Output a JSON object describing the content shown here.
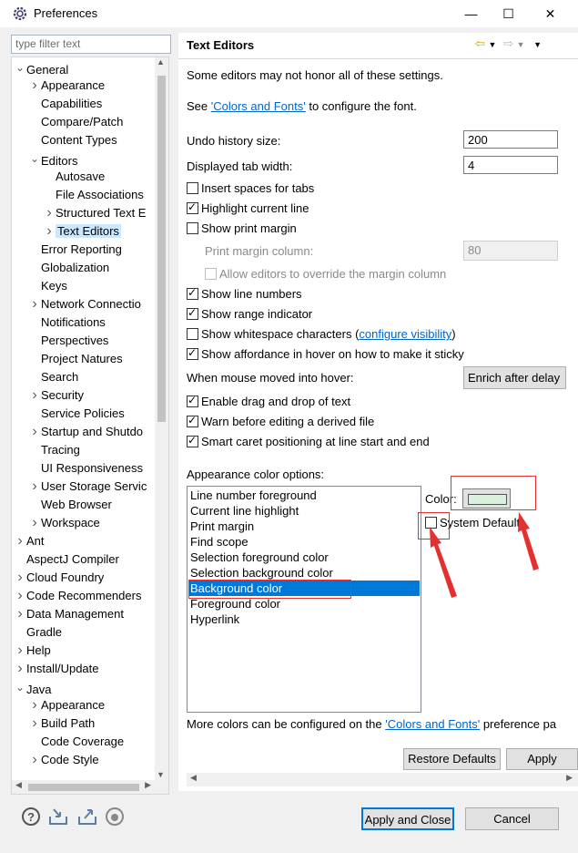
{
  "window": {
    "title": "Preferences",
    "controls": {
      "minimize": "—",
      "maximize": "☐",
      "close": "✕"
    }
  },
  "filter": {
    "placeholder": "type filter text"
  },
  "tree": {
    "items": [
      {
        "label": "General",
        "level": 0,
        "twisty": "expanded"
      },
      {
        "label": "Appearance",
        "level": 1,
        "twisty": "collapsed"
      },
      {
        "label": "Capabilities",
        "level": 1,
        "twisty": "none"
      },
      {
        "label": "Compare/Patch",
        "level": 1,
        "twisty": "none"
      },
      {
        "label": "Content Types",
        "level": 1,
        "twisty": "none"
      },
      {
        "label": "Editors",
        "level": 1,
        "twisty": "expanded"
      },
      {
        "label": "Autosave",
        "level": 2,
        "twisty": "none"
      },
      {
        "label": "File Associations",
        "level": 2,
        "twisty": "none"
      },
      {
        "label": "Structured Text E",
        "level": 2,
        "twisty": "collapsed"
      },
      {
        "label": "Text Editors",
        "level": 2,
        "twisty": "collapsed",
        "selected": true
      },
      {
        "label": "Error Reporting",
        "level": 1,
        "twisty": "none"
      },
      {
        "label": "Globalization",
        "level": 1,
        "twisty": "none"
      },
      {
        "label": "Keys",
        "level": 1,
        "twisty": "none"
      },
      {
        "label": "Network Connectio",
        "level": 1,
        "twisty": "collapsed"
      },
      {
        "label": "Notifications",
        "level": 1,
        "twisty": "none"
      },
      {
        "label": "Perspectives",
        "level": 1,
        "twisty": "none"
      },
      {
        "label": "Project Natures",
        "level": 1,
        "twisty": "none"
      },
      {
        "label": "Search",
        "level": 1,
        "twisty": "none"
      },
      {
        "label": "Security",
        "level": 1,
        "twisty": "collapsed"
      },
      {
        "label": "Service Policies",
        "level": 1,
        "twisty": "none"
      },
      {
        "label": "Startup and Shutdo",
        "level": 1,
        "twisty": "collapsed"
      },
      {
        "label": "Tracing",
        "level": 1,
        "twisty": "none"
      },
      {
        "label": "UI Responsiveness",
        "level": 1,
        "twisty": "none"
      },
      {
        "label": "User Storage Servic",
        "level": 1,
        "twisty": "collapsed"
      },
      {
        "label": "Web Browser",
        "level": 1,
        "twisty": "none"
      },
      {
        "label": "Workspace",
        "level": 1,
        "twisty": "collapsed"
      },
      {
        "label": "Ant",
        "level": 0,
        "twisty": "collapsed"
      },
      {
        "label": "AspectJ Compiler",
        "level": 0,
        "twisty": "none"
      },
      {
        "label": "Cloud Foundry",
        "level": 0,
        "twisty": "collapsed"
      },
      {
        "label": "Code Recommenders",
        "level": 0,
        "twisty": "collapsed"
      },
      {
        "label": "Data Management",
        "level": 0,
        "twisty": "collapsed"
      },
      {
        "label": "Gradle",
        "level": 0,
        "twisty": "none"
      },
      {
        "label": "Help",
        "level": 0,
        "twisty": "collapsed"
      },
      {
        "label": "Install/Update",
        "level": 0,
        "twisty": "collapsed"
      },
      {
        "label": "Java",
        "level": 0,
        "twisty": "expanded"
      },
      {
        "label": "Appearance",
        "level": 1,
        "twisty": "collapsed"
      },
      {
        "label": "Build Path",
        "level": 1,
        "twisty": "collapsed"
      },
      {
        "label": "Code Coverage",
        "level": 1,
        "twisty": "none"
      },
      {
        "label": "Code Style",
        "level": 1,
        "twisty": "collapsed"
      }
    ]
  },
  "page": {
    "title": "Text Editors",
    "note": "Some editors may not honor all of these settings.",
    "see_prefix": "See ",
    "see_link": "'Colors and Fonts'",
    "see_suffix": " to configure the font.",
    "undo_label": "Undo history size:",
    "undo_value": "200",
    "tab_label": "Displayed tab width:",
    "tab_value": "4",
    "insert_spaces": "Insert spaces for tabs",
    "highlight_line": "Highlight current line",
    "show_print_margin": "Show print margin",
    "print_margin_col_label": "Print margin column:",
    "print_margin_col_value": "80",
    "allow_override": "Allow editors to override the margin column",
    "show_line_numbers": "Show line numbers",
    "show_range": "Show range indicator",
    "show_whitespace": "Show whitespace characters (",
    "configure_visibility": "configure visibility",
    "show_whitespace_close": ")",
    "show_affordance": "Show affordance in hover on how to make it sticky",
    "hover_label": "When mouse moved into hover:",
    "hover_value": "Enrich after delay",
    "drag_drop": "Enable drag and drop of text",
    "warn_derived": "Warn before editing a derived file",
    "smart_caret": "Smart caret positioning at line start and end",
    "appearance_label": "Appearance color options:",
    "color_label": "Color:",
    "system_default": "System Default",
    "swatch_color": "#d8f0dc",
    "more_prefix": "More colors can be configured on the ",
    "more_link": "'Colors and Fonts'",
    "more_suffix": " preference pa",
    "restore_defaults": "Restore Defaults",
    "apply": "Apply"
  },
  "color_options": [
    "Line number foreground",
    "Current line highlight",
    "Print margin",
    "Find scope",
    "Selection foreground color",
    "Selection background color",
    "Background color",
    "Foreground color",
    "Hyperlink"
  ],
  "selected_color_option": "Background color",
  "footer": {
    "apply_close": "Apply and Close",
    "cancel": "Cancel"
  },
  "accent_colors": {
    "selection": "#0078d7",
    "link": "#0066cc",
    "annotation": "#e53030"
  }
}
